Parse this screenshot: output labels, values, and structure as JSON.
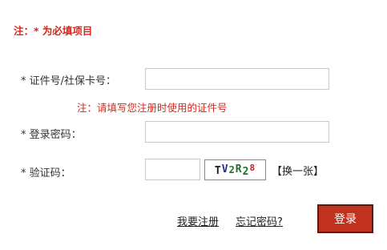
{
  "notice": {
    "required_note": "注：* 为必填项目"
  },
  "form": {
    "id_label": "* 证件号/社保卡号：",
    "id_value": "",
    "id_hint": "注：请填写您注册时使用的证件号",
    "password_label": "* 登录密码：",
    "password_value": "",
    "captcha_label": "* 验证码：",
    "captcha_value": "",
    "captcha_chars": [
      {
        "char": "T",
        "color": "#1a1a1a"
      },
      {
        "char": "V",
        "color": "#1c2f8c"
      },
      {
        "char": "2",
        "color": "#1f6f2a"
      },
      {
        "char": "R",
        "color": "#1f6f2a"
      },
      {
        "char": "2",
        "color": "#1f6f2a"
      },
      {
        "char": "8",
        "color": "#c8241c"
      }
    ],
    "refresh_label": "【换一张】"
  },
  "actions": {
    "register_label": "我要注册",
    "forgot_label": "忘记密码?",
    "login_label": "登录"
  }
}
